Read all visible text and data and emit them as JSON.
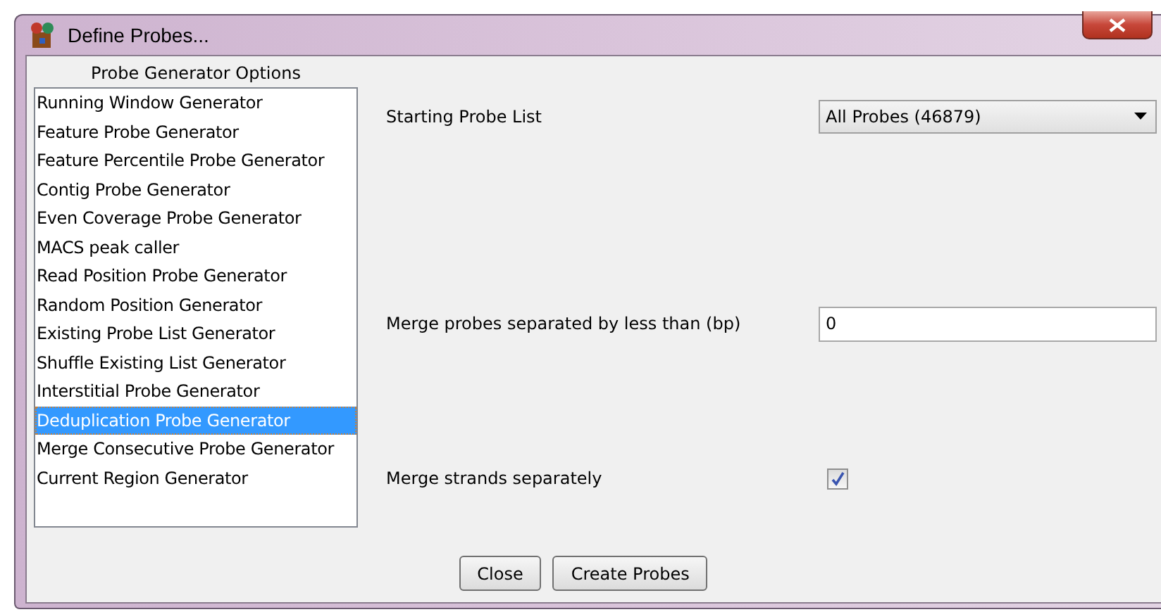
{
  "window": {
    "title": "Define Probes..."
  },
  "generator_list": {
    "title": "Probe Generator Options",
    "items": [
      {
        "label": "Running Window Generator",
        "selected": false
      },
      {
        "label": "Feature Probe Generator",
        "selected": false
      },
      {
        "label": "Feature Percentile Probe Generator",
        "selected": false
      },
      {
        "label": "Contig Probe Generator",
        "selected": false
      },
      {
        "label": "Even Coverage Probe Generator",
        "selected": false
      },
      {
        "label": "MACS peak caller",
        "selected": false
      },
      {
        "label": "Read Position Probe Generator",
        "selected": false
      },
      {
        "label": "Random Position Generator",
        "selected": false
      },
      {
        "label": "Existing Probe List Generator",
        "selected": false
      },
      {
        "label": "Shuffle Existing List Generator",
        "selected": false
      },
      {
        "label": "Interstitial Probe Generator",
        "selected": false
      },
      {
        "label": "Deduplication Probe Generator",
        "selected": true
      },
      {
        "label": "Merge Consecutive Probe Generator",
        "selected": false
      },
      {
        "label": "Current Region Generator",
        "selected": false
      }
    ]
  },
  "options": [
    {
      "kind": "dropdown",
      "label": "Starting Probe List",
      "value": "All Probes (46879)"
    },
    {
      "kind": "text",
      "label": "Merge probes separated by less than (bp)",
      "value": "0"
    },
    {
      "kind": "checkbox",
      "label": "Merge strands separately",
      "checked": true
    }
  ],
  "buttons": [
    "Close",
    "Create Probes"
  ]
}
